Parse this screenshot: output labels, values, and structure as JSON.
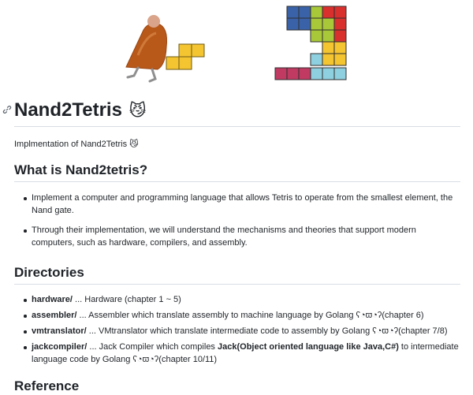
{
  "banner": {
    "alt": "Nand2Tetris banner"
  },
  "title": {
    "text": "Nand2Tetris",
    "emoji": "😼"
  },
  "intro": {
    "text": "Implmentation of Nand2Tetris",
    "emoji": "😼"
  },
  "what": {
    "heading": "What is Nand2tetris?",
    "items": [
      "Implement a computer and programming language that allows Tetris to operate from the smallest element, the Nand gate.",
      "Through their implementation, we will understand the mechanisms and theories that support modern computers, such as hardware, compilers, and assembly."
    ]
  },
  "directories": {
    "heading": "Directories",
    "items": [
      {
        "name": "hardware/",
        "text": " ... Hardware (chapter 1 ~ 5)"
      },
      {
        "name": "assembler/",
        "text": " ... Assembler which translate assembly to machine language by Golang ʕ◔ϖ◔ʔ(chapter 6)"
      },
      {
        "name": "vmtranslator/",
        "text": " ... VMtranslator which translate intermediate code to assembly by Golang ʕ◔ϖ◔ʔ(chapter 7/8)"
      },
      {
        "name": "jackcompiler/",
        "text": " ... Jack Compiler which compiles ",
        "bold": "Jack(Object oriented language like Java,C#)",
        "text2": " to intermediate language code by Golang ʕ◔ϖ◔ʔ(chapter 10/11)"
      }
    ]
  },
  "reference": {
    "heading": "Reference"
  },
  "colors": {
    "text": "#1f2328",
    "rule": "#d8dee4",
    "link": "#0969da"
  }
}
